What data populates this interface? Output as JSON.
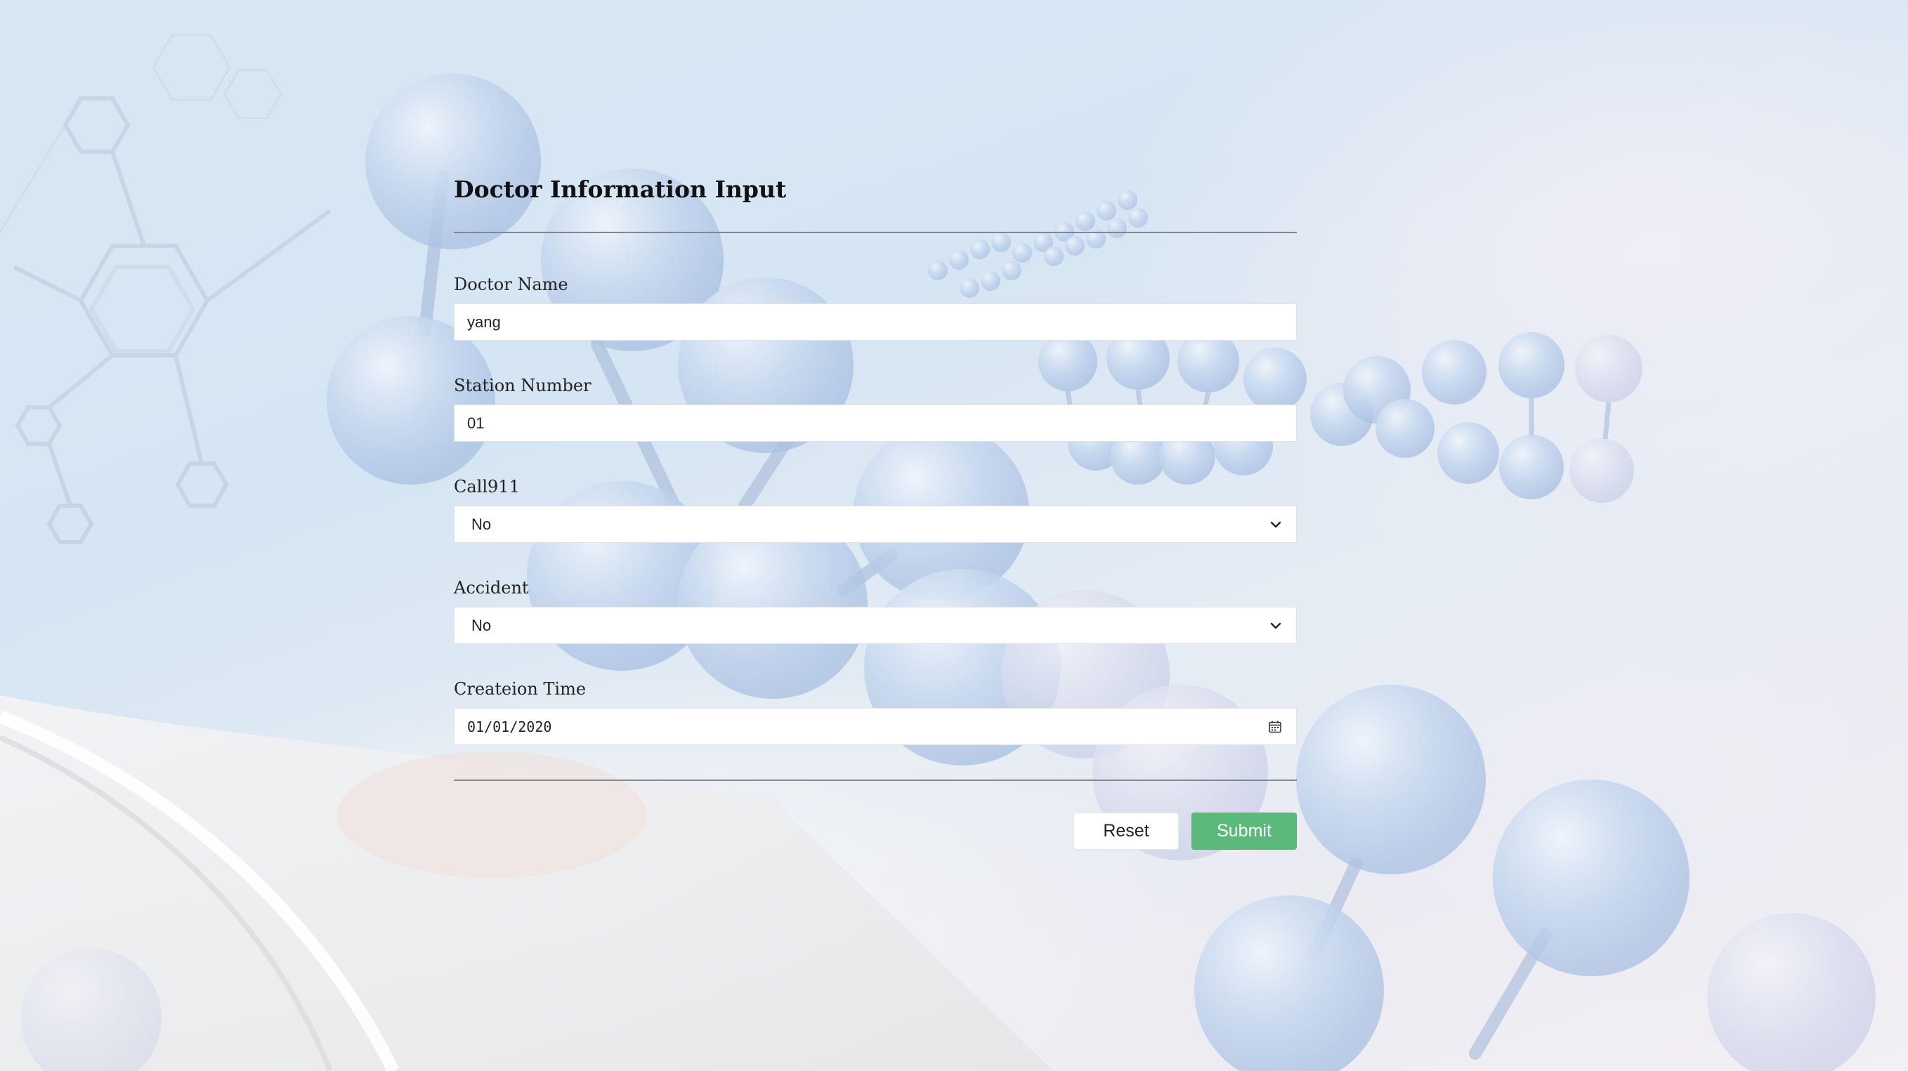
{
  "form": {
    "title": "Doctor Information Input",
    "fields": [
      {
        "label": "Doctor Name",
        "value": "yang",
        "type": "text"
      },
      {
        "label": "Station Number",
        "value": "01",
        "type": "text"
      },
      {
        "label": "Call911",
        "value": "No",
        "type": "select"
      },
      {
        "label": "Accident",
        "value": "No",
        "type": "select"
      },
      {
        "label": "Createion Time",
        "value": "01/01/2020",
        "type": "date"
      }
    ],
    "buttons": {
      "reset_label": "Reset",
      "submit_label": "Submit"
    }
  },
  "icons": {
    "select_arrow": "chevron-down-icon",
    "date_picker": "calendar-icon"
  },
  "colors": {
    "submit_button": "#5cb97c",
    "reset_button": "#ffffff",
    "background": "#d9e7f4",
    "divider": "#7f8890"
  }
}
